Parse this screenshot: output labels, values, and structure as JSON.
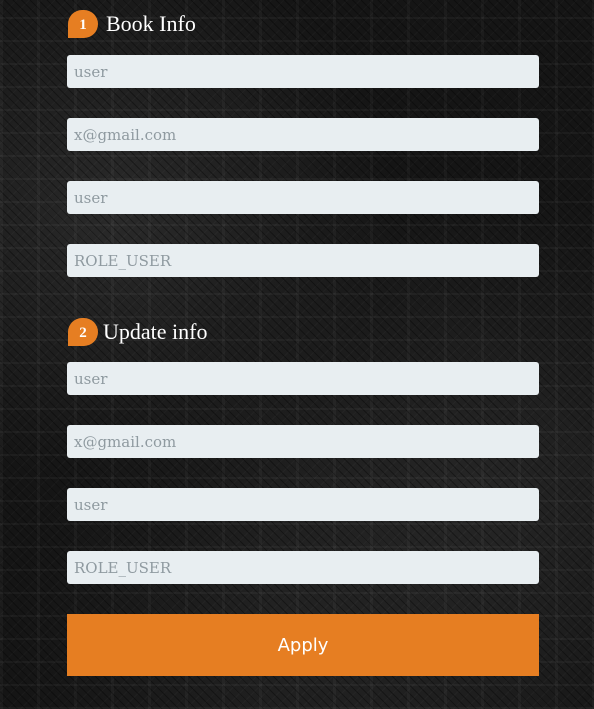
{
  "sections": [
    {
      "number": "1",
      "title": "Book Info",
      "fields": [
        {
          "placeholder": "user"
        },
        {
          "placeholder": "x@gmail.com"
        },
        {
          "placeholder": "user"
        },
        {
          "placeholder": "ROLE_USER"
        }
      ]
    },
    {
      "number": "2",
      "title": "Update info",
      "fields": [
        {
          "placeholder": "user"
        },
        {
          "placeholder": "x@gmail.com"
        },
        {
          "placeholder": "user"
        },
        {
          "placeholder": "ROLE_USER"
        }
      ]
    }
  ],
  "apply_button": {
    "label": "Apply"
  },
  "colors": {
    "accent": "#e67e22",
    "field_background": "#e8eef1",
    "placeholder_text": "#8f9aa0",
    "heading_text": "#ffffff"
  }
}
